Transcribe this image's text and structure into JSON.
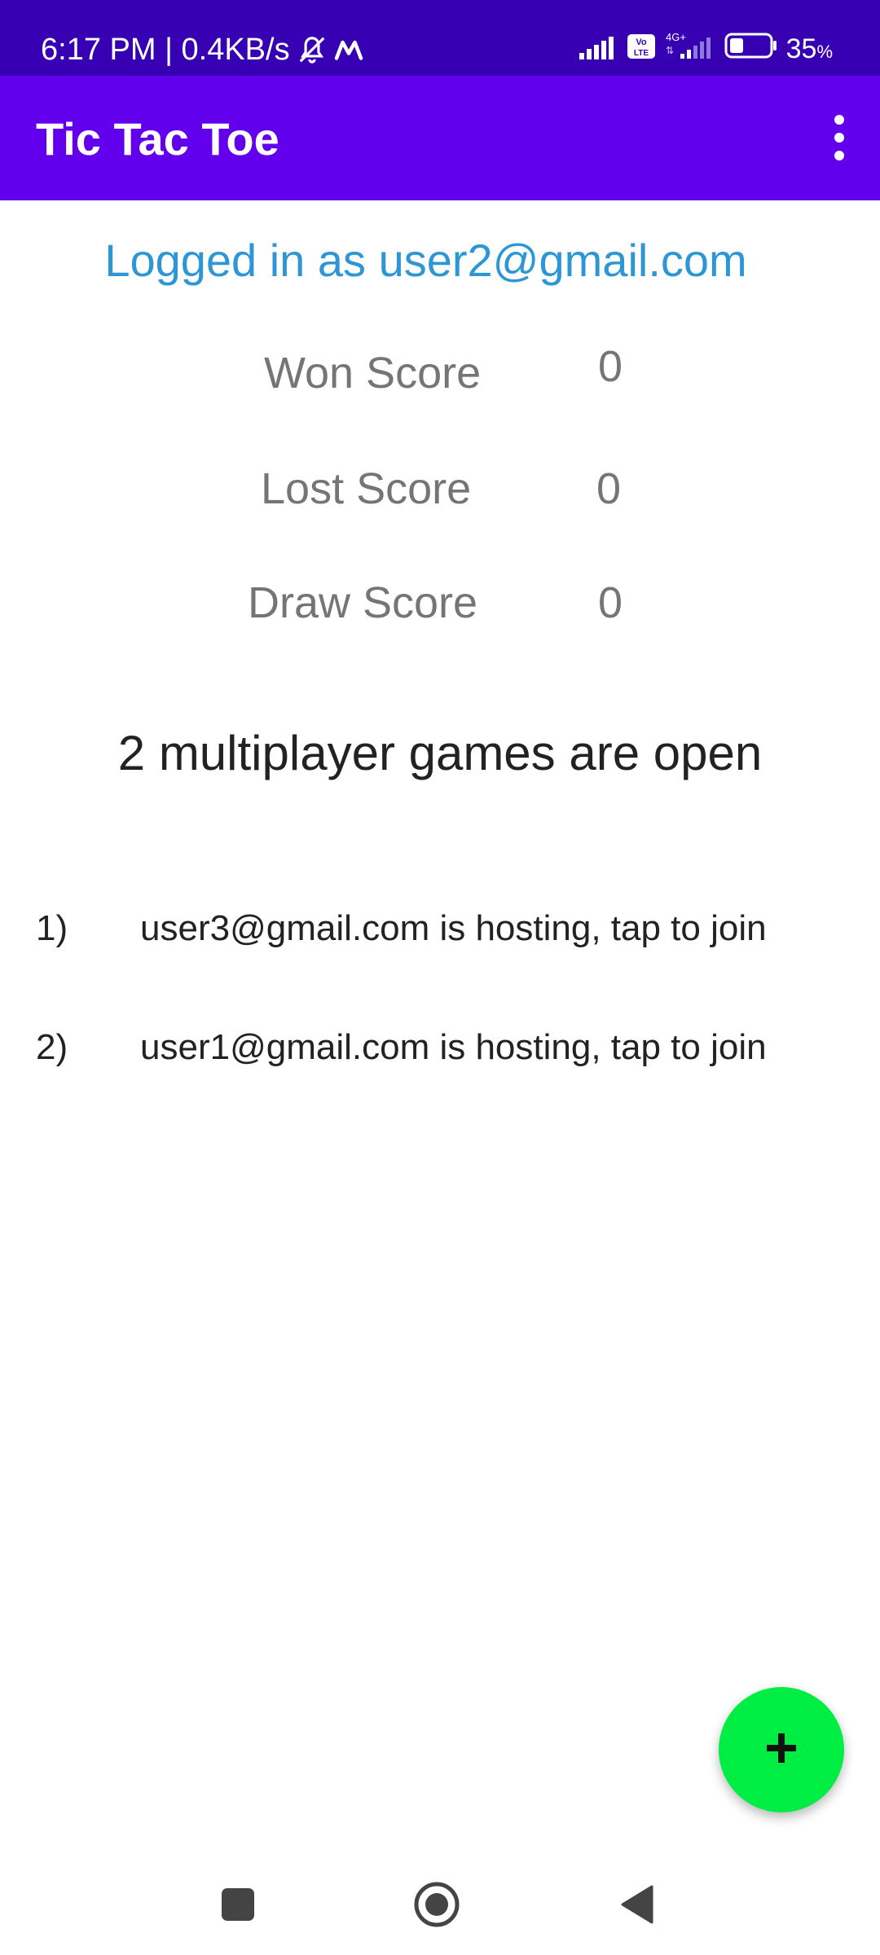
{
  "status_bar": {
    "time_speed": "6:17 PM | 0.4KB/s",
    "network_label": "4G+",
    "volte_label": "Vo LTE",
    "battery_level": 35,
    "battery_text": "35",
    "battery_unit": "%"
  },
  "app_bar": {
    "title": "Tic Tac Toe"
  },
  "user": {
    "logged_in_text": "Logged in as user2@gmail.com"
  },
  "scores": {
    "won_label": "Won Score",
    "won_value": "0",
    "lost_label": "Lost Score",
    "lost_value": "0",
    "draw_label": "Draw Score",
    "draw_value": "0"
  },
  "games": {
    "heading": "2 multiplayer games are open",
    "items": [
      {
        "index": "1)",
        "text": "user3@gmail.com is hosting, tap to join"
      },
      {
        "index": "2)",
        "text": "user1@gmail.com is hosting, tap to join"
      }
    ]
  },
  "fab": {
    "icon": "plus-icon",
    "color": "#00ee44"
  },
  "colors": {
    "status_bar": "#3700b3",
    "app_bar": "#6200ee",
    "logged_in": "#2d97d6"
  },
  "nav_bar": {
    "icons": [
      "recents-square-icon",
      "home-circle-icon",
      "back-triangle-icon"
    ]
  }
}
